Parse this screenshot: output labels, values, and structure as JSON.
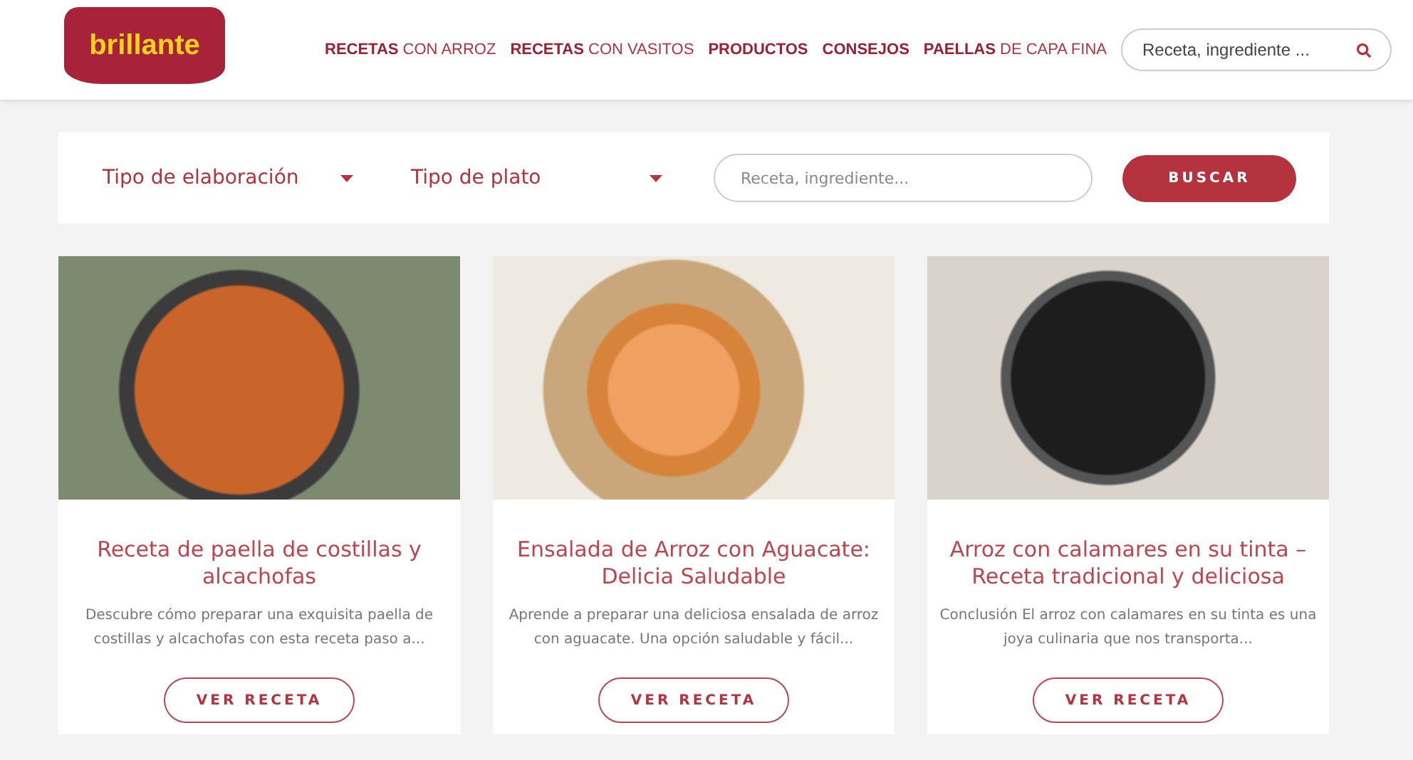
{
  "header": {
    "logo": "brillante",
    "nav": [
      "**RECETAS** CON ARROZ",
      "**RECETAS** CON VASITOS",
      "**PRODUCTOS**",
      "**CONSEJOS**",
      "**PAELLAS** DE CAPA FINA"
    ],
    "search": {
      "placeholder": "Receta, ingrediente ..."
    }
  },
  "filters": {
    "selects": [
      "Tipo de elaboración",
      "Tipo de plato"
    ],
    "search": {
      "placeholder": "Receta, ingrediente..."
    },
    "button": "BUSCAR"
  },
  "cards": [
    {
      "kind": "paella",
      "title": "Receta de paella de costillas y alcachofas",
      "excerpt": "Descubre cómo preparar una exquisita paella de costillas y alcachofas con esta receta paso a...",
      "button": "VER RECETA"
    },
    {
      "kind": "bowl",
      "title": "Ensalada de Arroz con Aguacate: Delicia Saludable",
      "excerpt": "Aprende a preparar una deliciosa ensalada de arroz con aguacate. Una opción saludable y fácil...",
      "button": "VER RECETA"
    },
    {
      "kind": "black",
      "title": "Arroz con calamares en su tinta – Receta tradicional y deliciosa",
      "excerpt": "Conclusión El arroz con calamares en su tinta es una joya culinaria que nos transporta...",
      "button": "VER RECETA"
    }
  ]
}
